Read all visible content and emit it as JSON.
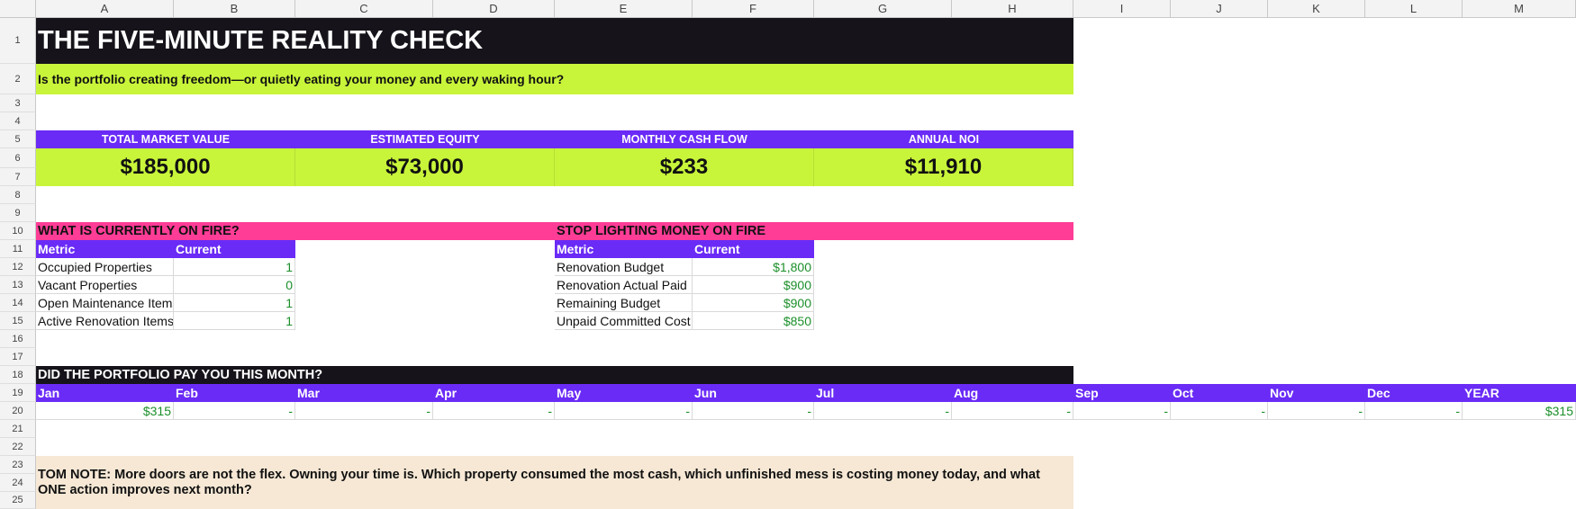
{
  "columns": [
    "A",
    "B",
    "C",
    "D",
    "E",
    "F",
    "G",
    "H",
    "I",
    "J",
    "K",
    "L",
    "M"
  ],
  "rows": [
    "1",
    "2",
    "3",
    "4",
    "5",
    "6",
    "7",
    "8",
    "9",
    "10",
    "11",
    "12",
    "13",
    "14",
    "15",
    "16",
    "17",
    "18",
    "19",
    "20",
    "21",
    "22",
    "23",
    "24",
    "25"
  ],
  "title": "THE FIVE-MINUTE REALITY CHECK",
  "subtitle": "Is the portfolio creating freedom—or quietly eating your money and every waking hour?",
  "kpis": [
    {
      "label": "TOTAL MARKET VALUE",
      "value": "$185,000"
    },
    {
      "label": "ESTIMATED EQUITY",
      "value": "$73,000"
    },
    {
      "label": "MONTHLY CASH FLOW",
      "value": "$233"
    },
    {
      "label": "ANNUAL NOI",
      "value": "$11,910"
    }
  ],
  "fire": {
    "title": "WHAT IS CURRENTLY ON FIRE?",
    "headers": [
      "Metric",
      "Current"
    ],
    "rows": [
      {
        "metric": "Occupied Properties",
        "value": "1"
      },
      {
        "metric": "Vacant Properties",
        "value": "0"
      },
      {
        "metric": "Open Maintenance Items",
        "value": "1"
      },
      {
        "metric": "Active Renovation Items",
        "value": "1"
      }
    ]
  },
  "stop": {
    "title": "STOP LIGHTING MONEY ON FIRE",
    "headers": [
      "Metric",
      "Current"
    ],
    "rows": [
      {
        "metric": "Renovation Budget",
        "value": "$1,800"
      },
      {
        "metric": "Renovation Actual Paid",
        "value": "$900"
      },
      {
        "metric": "Remaining Budget",
        "value": "$900"
      },
      {
        "metric": "Unpaid Committed Cost",
        "value": "$850"
      }
    ]
  },
  "monthly": {
    "title": "DID THE PORTFOLIO PAY YOU THIS MONTH?",
    "months": [
      "Jan",
      "Feb",
      "Mar",
      "Apr",
      "May",
      "Jun",
      "Jul",
      "Aug",
      "Sep",
      "Oct",
      "Nov",
      "Dec",
      "YEAR"
    ],
    "values": [
      "$315",
      "-",
      "-",
      "-",
      "-",
      "-",
      "-",
      "-",
      "-",
      "-",
      "-",
      "-",
      "$315"
    ]
  },
  "note": "TOM NOTE: More doors are not the flex. Owning your time is. Which property consumed the most cash, which unfinished mess is costing money today, and what ONE action improves next month?",
  "colors": {
    "dark": "#16141a",
    "lime": "#c8f53a",
    "purple": "#6a2bf6",
    "pink": "#ff3d97",
    "cream": "#f6e8d5",
    "positive": "#1b8f2a"
  }
}
